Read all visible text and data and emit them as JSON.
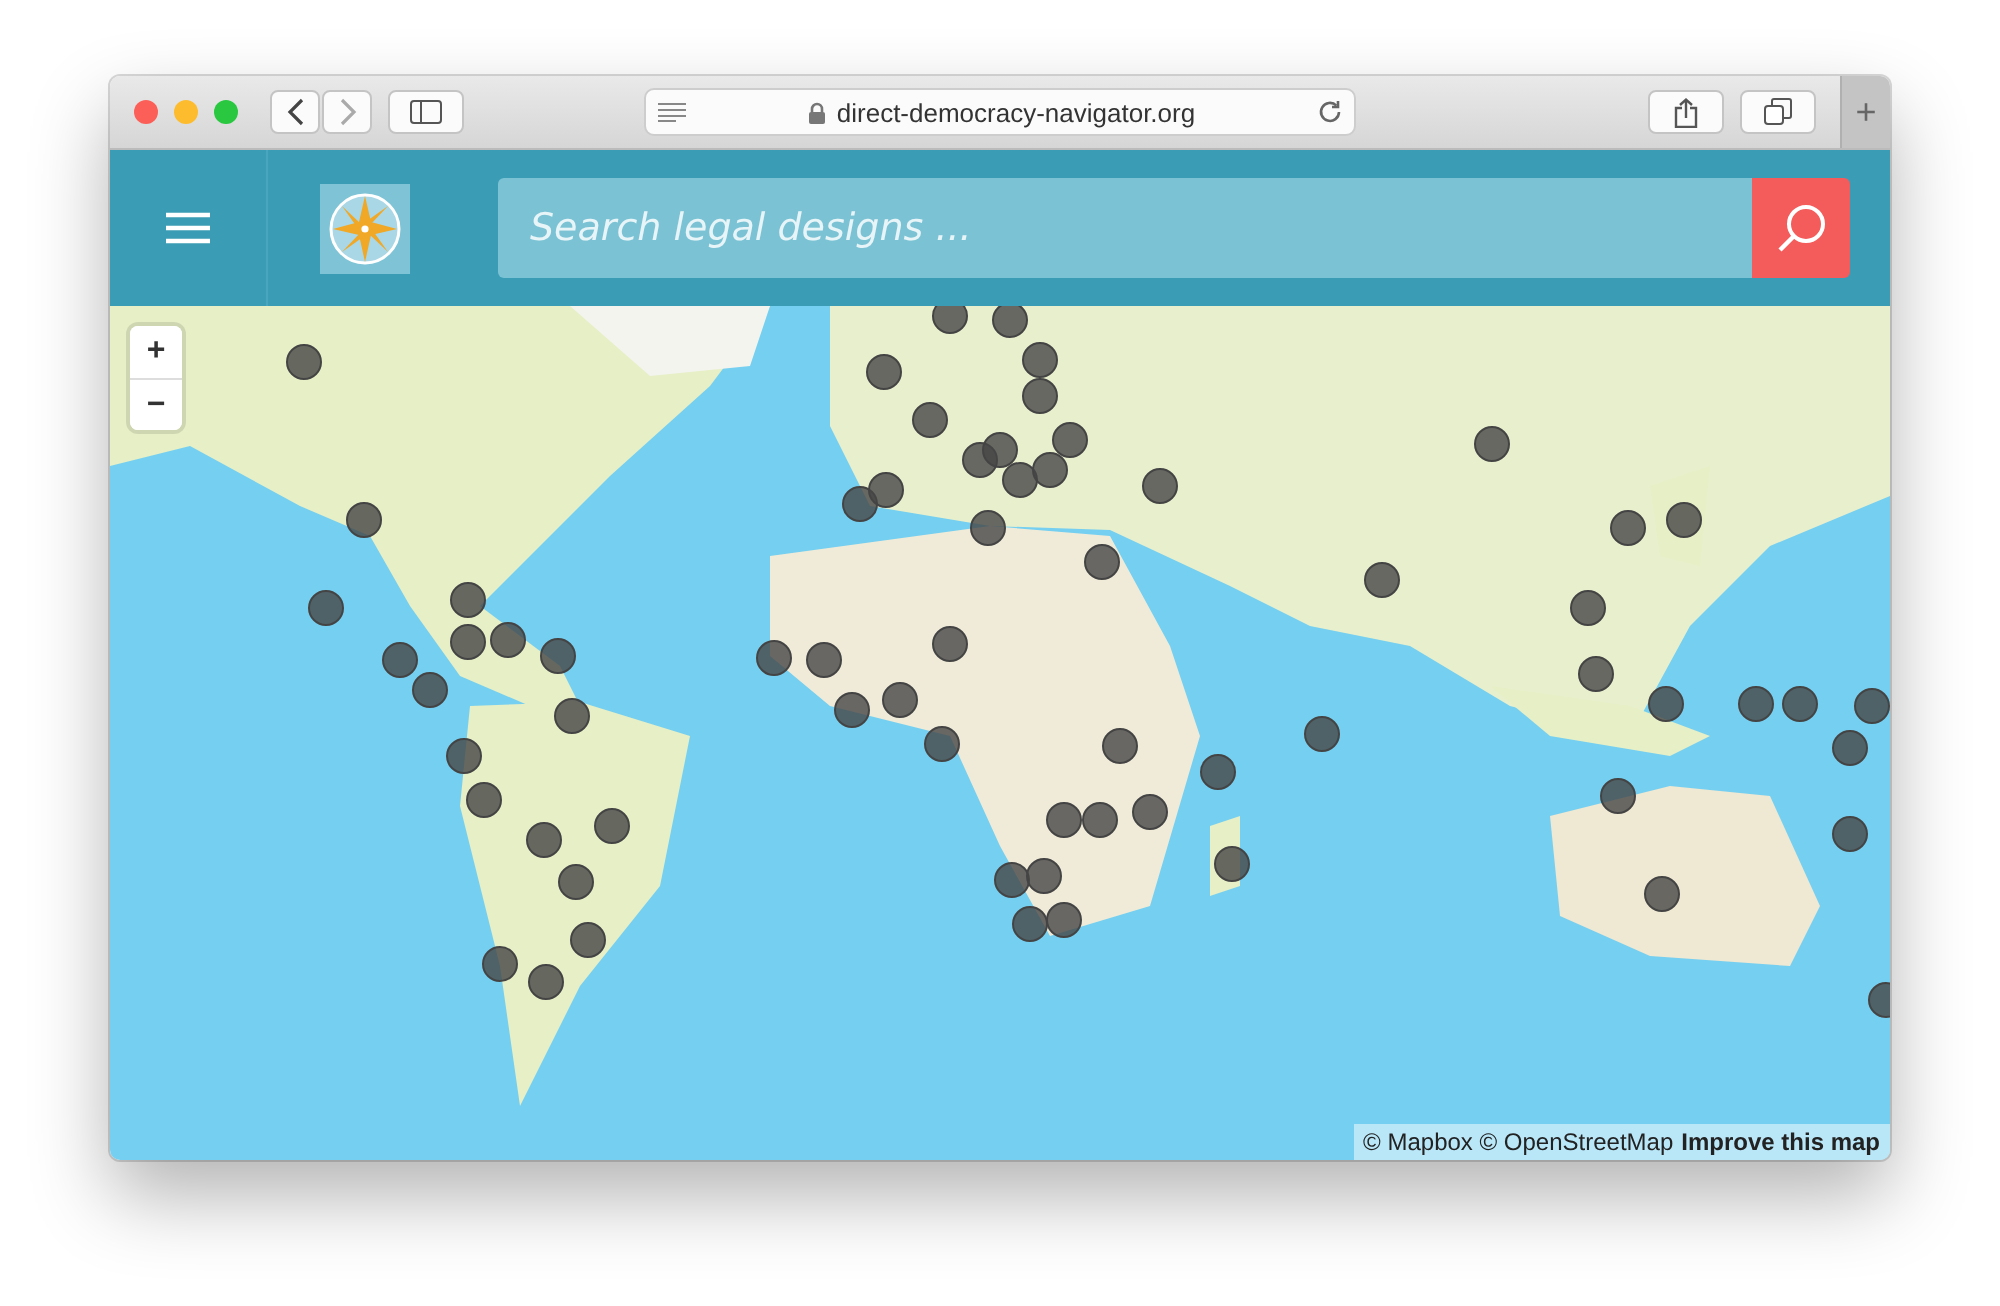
{
  "browser": {
    "url": "direct-democracy-navigator.org",
    "new_tab": "+"
  },
  "header": {
    "search": {
      "placeholder": "Search legal designs ..."
    }
  },
  "map": {
    "kind": "picture",
    "zoom_in": "+",
    "zoom_out": "−",
    "attribution": "© Mapbox © OpenStreetMap",
    "attribution_link": "Improve this map"
  }
}
